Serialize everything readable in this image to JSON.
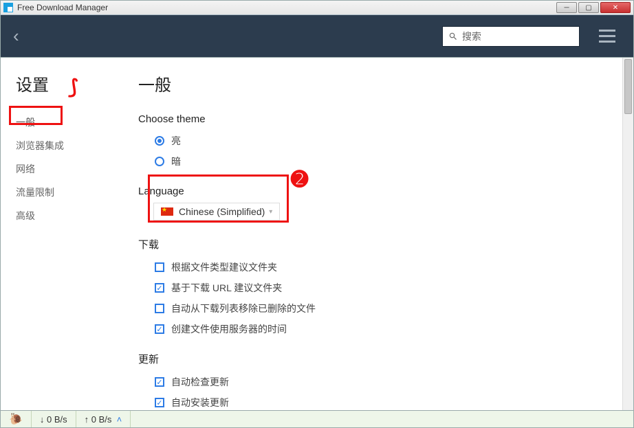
{
  "titlebar": {
    "title": "Free Download Manager"
  },
  "toolbar": {
    "search_placeholder": "搜索"
  },
  "sidebar": {
    "title": "设置",
    "items": [
      "一般",
      "浏览器集成",
      "网络",
      "流量限制",
      "高级"
    ]
  },
  "panel": {
    "title": "一般",
    "theme_section": "Choose theme",
    "theme_light": "亮",
    "theme_dark": "暗",
    "language_section": "Language",
    "language_value": "Chinese (Simplified)",
    "download_section": "下载",
    "dl_opt1": "根据文件类型建议文件夹",
    "dl_opt2": "基于下载 URL 建议文件夹",
    "dl_opt3": "自动从下载列表移除已删除的文件",
    "dl_opt4": "创建文件使用服务器的时间",
    "update_section": "更新",
    "upd_opt1": "自动检查更新",
    "upd_opt2": "自动安装更新"
  },
  "statusbar": {
    "down_speed": "↓  0 B/s",
    "up_speed": "↑  0 B/s"
  }
}
